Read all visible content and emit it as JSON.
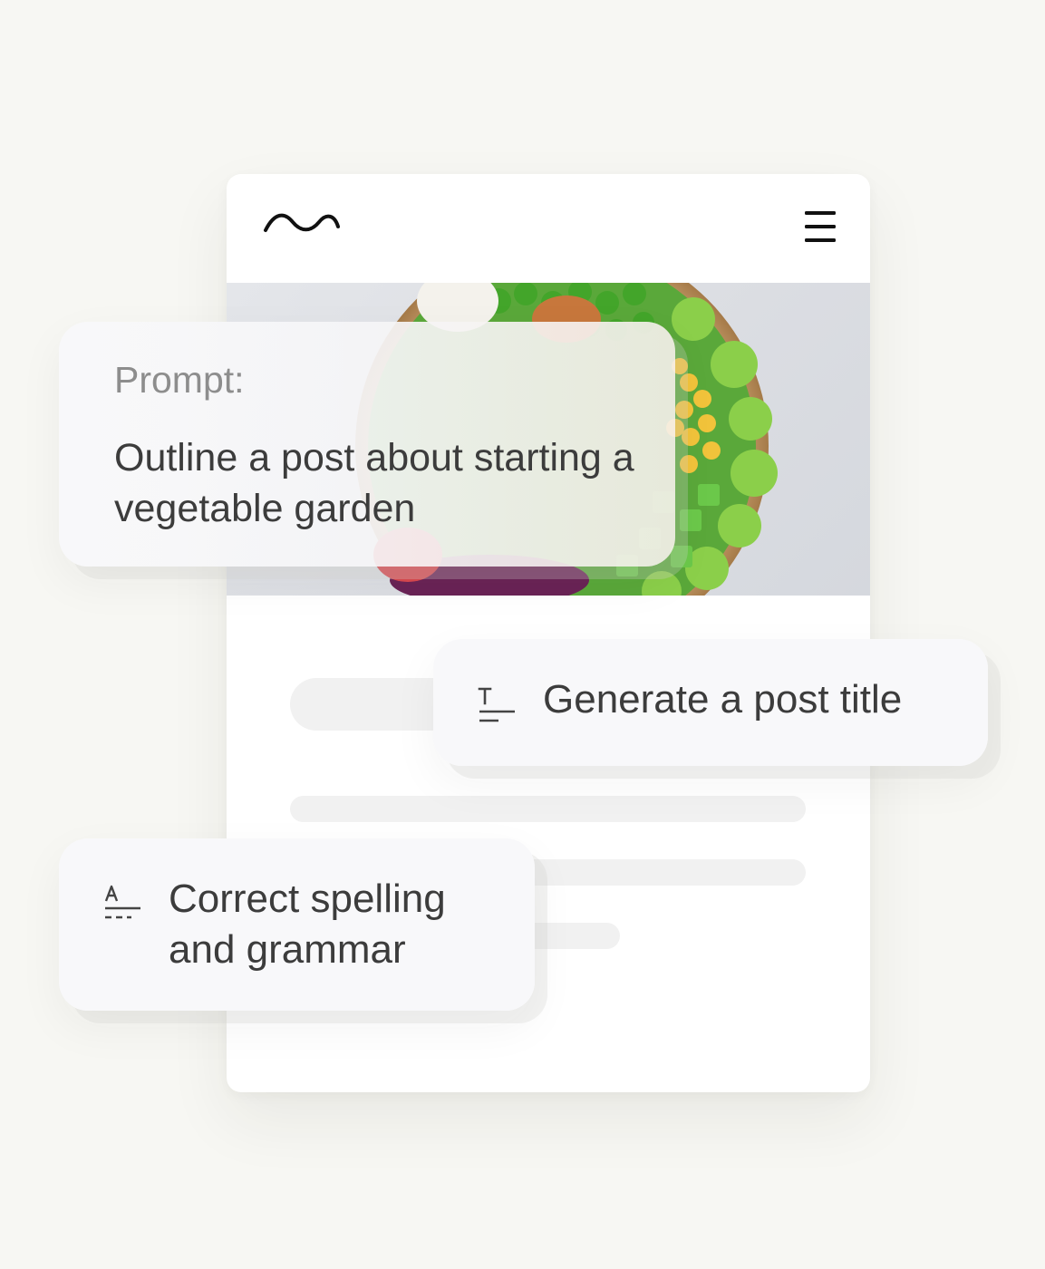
{
  "site": {
    "logo_icon": "wave-logo-icon",
    "menu_icon": "hamburger-menu-icon",
    "hero_image": "salad-bowl-photo"
  },
  "prompt_card": {
    "label": "Prompt:",
    "text": "Outline a post about starting a vegetable garden"
  },
  "actions": {
    "title": {
      "label": "Generate a post title",
      "icon": "title-format-icon"
    },
    "grammar": {
      "label": "Correct spelling and grammar",
      "icon": "spellcheck-icon"
    }
  },
  "colors": {
    "background": "#f7f7f3",
    "card": "#ffffff",
    "text": "#3c3c3c",
    "muted": "#8d8d8d",
    "skeleton": "#f1f1f1"
  }
}
